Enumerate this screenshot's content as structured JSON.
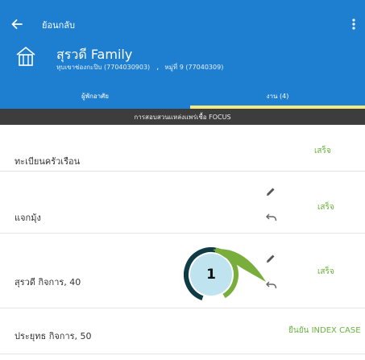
{
  "appbar": {
    "back_label": "ย้อนกลับ",
    "family_name": "สุรวดี Family",
    "family_address": "หุบเขาช่องกะปิบ (7704030903)",
    "family_separator": ",",
    "family_village": "หมู่ที่ 9 (77040309)",
    "colors": {
      "primary": "#1e7fd0",
      "tab_indicator": "#f4ea84"
    }
  },
  "tabs": [
    {
      "label": "ผู้พักอาศัย",
      "selected": false
    },
    {
      "label": "งาน (4)",
      "selected": true
    }
  ],
  "subheader": "การสอบสวนแหล่งแพร่เชื้อ FOCUS",
  "tasks": [
    {
      "name": "ทะเบียนครัวเรือน",
      "status": "เสร็จ",
      "has_actions": false
    },
    {
      "name": "แจกมุ้ง",
      "status": "เสร็จ",
      "has_actions": true
    },
    {
      "name": "สุรวดี  กิจการ, 40",
      "status": "เสร็จ",
      "has_actions": true
    },
    {
      "name": "ประยุทธ  กิจการ, 50",
      "status": "ยืนยัน INDEX CASE",
      "has_actions": false
    }
  ],
  "callout": {
    "number": "1",
    "color": "#7aae3c"
  },
  "icons": {
    "back": "arrow-left-icon",
    "menu": "more-vert-icon",
    "house": "house-icon",
    "edit": "pencil-icon",
    "undo": "undo-icon"
  },
  "status_color": "#6cb33f"
}
